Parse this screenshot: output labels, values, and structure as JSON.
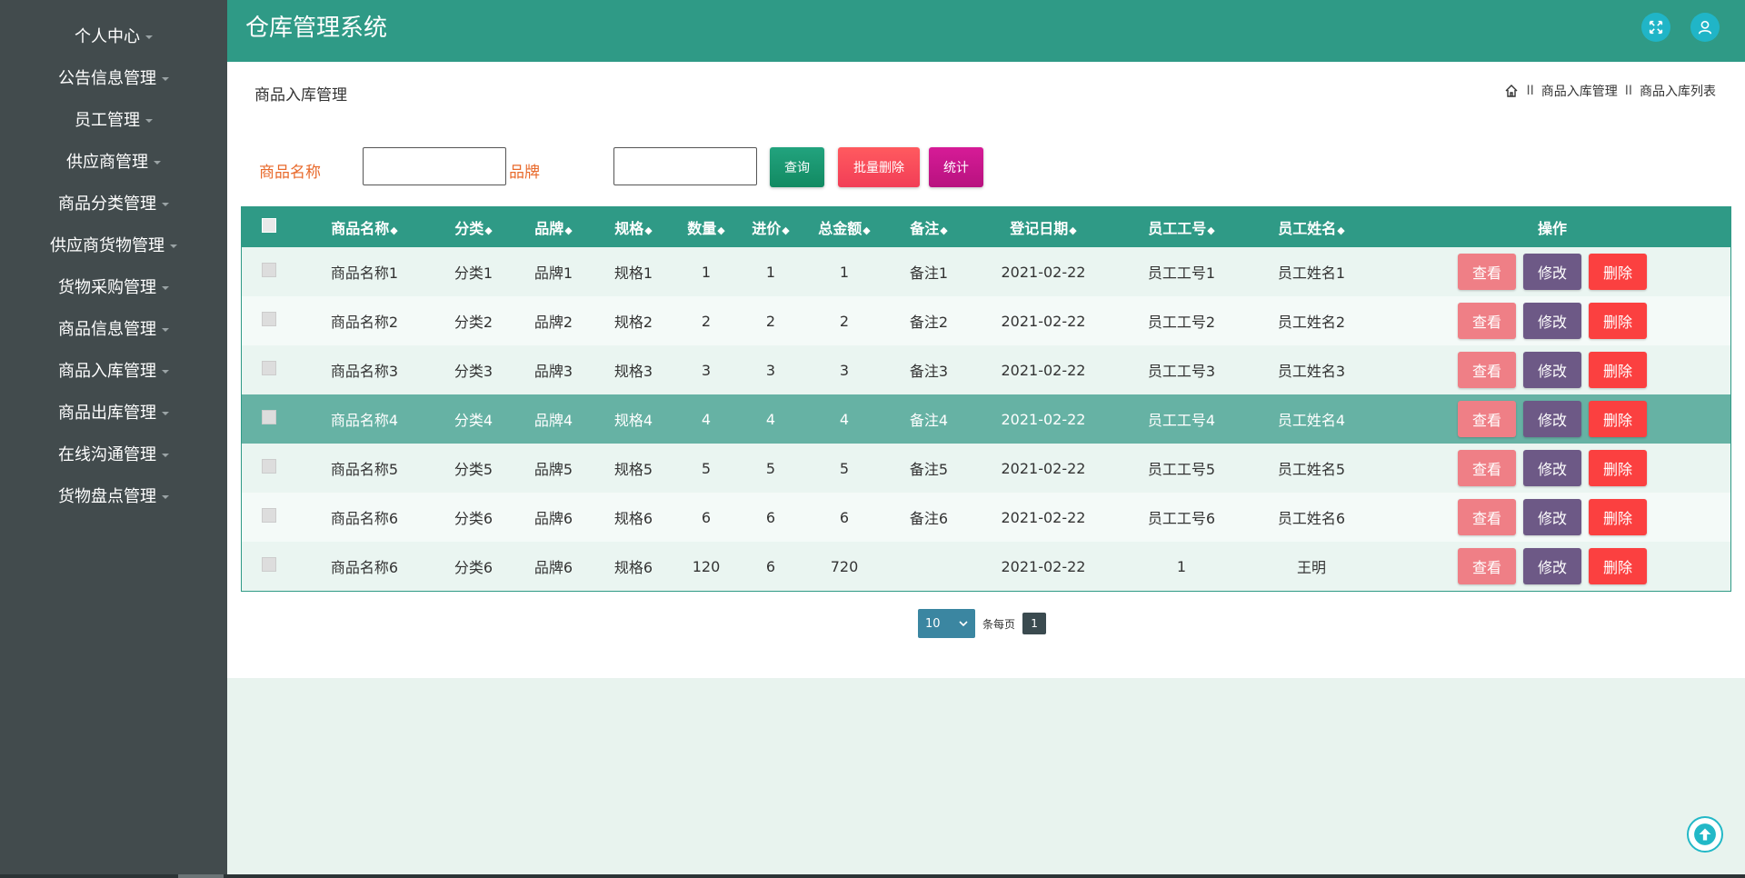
{
  "app": {
    "title": "仓库管理系统"
  },
  "sidebar": {
    "items": [
      {
        "label": "个人中心"
      },
      {
        "label": "公告信息管理"
      },
      {
        "label": "员工管理"
      },
      {
        "label": "供应商管理"
      },
      {
        "label": "商品分类管理"
      },
      {
        "label": "供应商货物管理"
      },
      {
        "label": "货物采购管理"
      },
      {
        "label": "商品信息管理"
      },
      {
        "label": "商品入库管理"
      },
      {
        "label": "商品出库管理"
      },
      {
        "label": "在线沟通管理"
      },
      {
        "label": "货物盘点管理"
      }
    ]
  },
  "page": {
    "title": "商品入库管理",
    "breadcrumb": [
      "商品入库管理",
      "商品入库列表"
    ],
    "breadcrumb_sep": "II"
  },
  "search": {
    "name_label": "商品名称",
    "name_value": "",
    "brand_label": "品牌",
    "brand_value": "",
    "query_label": "查询",
    "batch_delete_label": "批量删除",
    "stats_label": "统计"
  },
  "table": {
    "headers": [
      "商品名称",
      "分类",
      "品牌",
      "规格",
      "数量",
      "进价",
      "总金额",
      "备注",
      "登记日期",
      "员工工号",
      "员工姓名",
      "操作"
    ],
    "sort_glyph": "◆",
    "rows": [
      [
        "商品名称1",
        "分类1",
        "品牌1",
        "规格1",
        "1",
        "1",
        "1",
        "备注1",
        "2021-02-22",
        "员工工号1",
        "员工姓名1"
      ],
      [
        "商品名称2",
        "分类2",
        "品牌2",
        "规格2",
        "2",
        "2",
        "2",
        "备注2",
        "2021-02-22",
        "员工工号2",
        "员工姓名2"
      ],
      [
        "商品名称3",
        "分类3",
        "品牌3",
        "规格3",
        "3",
        "3",
        "3",
        "备注3",
        "2021-02-22",
        "员工工号3",
        "员工姓名3"
      ],
      [
        "商品名称4",
        "分类4",
        "品牌4",
        "规格4",
        "4",
        "4",
        "4",
        "备注4",
        "2021-02-22",
        "员工工号4",
        "员工姓名4"
      ],
      [
        "商品名称5",
        "分类5",
        "品牌5",
        "规格5",
        "5",
        "5",
        "5",
        "备注5",
        "2021-02-22",
        "员工工号5",
        "员工姓名5"
      ],
      [
        "商品名称6",
        "分类6",
        "品牌6",
        "规格6",
        "6",
        "6",
        "6",
        "备注6",
        "2021-02-22",
        "员工工号6",
        "员工姓名6"
      ],
      [
        "商品名称6",
        "分类6",
        "品牌6",
        "规格6",
        "120",
        "6",
        "720",
        "",
        "2021-02-22",
        "1",
        "王明"
      ]
    ],
    "hover_row": 3,
    "actions": {
      "view": "查看",
      "edit": "修改",
      "delete": "删除"
    }
  },
  "pagination": {
    "page_size": "10",
    "per_page_label": "条每页",
    "current_page": "1"
  },
  "colors": {
    "header": "#2f9a86",
    "sidebar": "#424b4d",
    "view": "#ef7f86",
    "edit": "#6d5986",
    "delete": "#fb4040",
    "query": "#1a9a72",
    "batch_delete": "#fb4a5a",
    "stats": "#c4178a"
  },
  "icons": [
    "fullscreen-icon",
    "user-icon",
    "home-icon",
    "back-to-top-icon",
    "chevron-down-icon"
  ]
}
